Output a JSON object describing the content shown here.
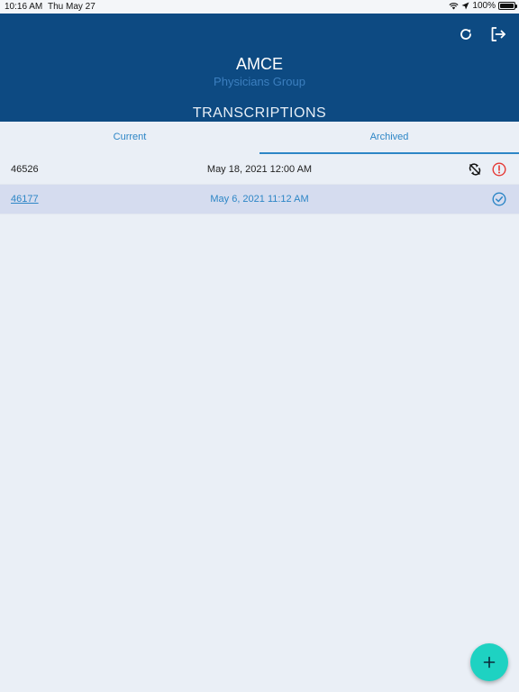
{
  "status_bar": {
    "time": "10:16 AM",
    "date": "Thu May 27",
    "battery": "100%"
  },
  "header": {
    "title": "AMCE",
    "subtitle": "Physicians Group",
    "section_title": "TRANSCRIPTIONS",
    "refresh_icon": "refresh-icon",
    "logout_icon": "logout-icon"
  },
  "tabs": [
    {
      "label": "Current",
      "selected": false
    },
    {
      "label": "Archived",
      "selected": true
    }
  ],
  "rows": [
    {
      "id": "46526",
      "date": "May 18, 2021 12:00 AM",
      "icons": [
        "sync-off-icon",
        "alert-icon"
      ],
      "selected": false
    },
    {
      "id": "46177",
      "date": "May 6, 2021 11:12 AM",
      "icons": [
        "check-circle-icon"
      ],
      "selected": true
    }
  ],
  "fab": {
    "icon": "plus-icon"
  },
  "colors": {
    "header_bg": "#0d4a82",
    "accent": "#2d86c6",
    "alert": "#e53935",
    "fab": "#1ed2c2"
  }
}
